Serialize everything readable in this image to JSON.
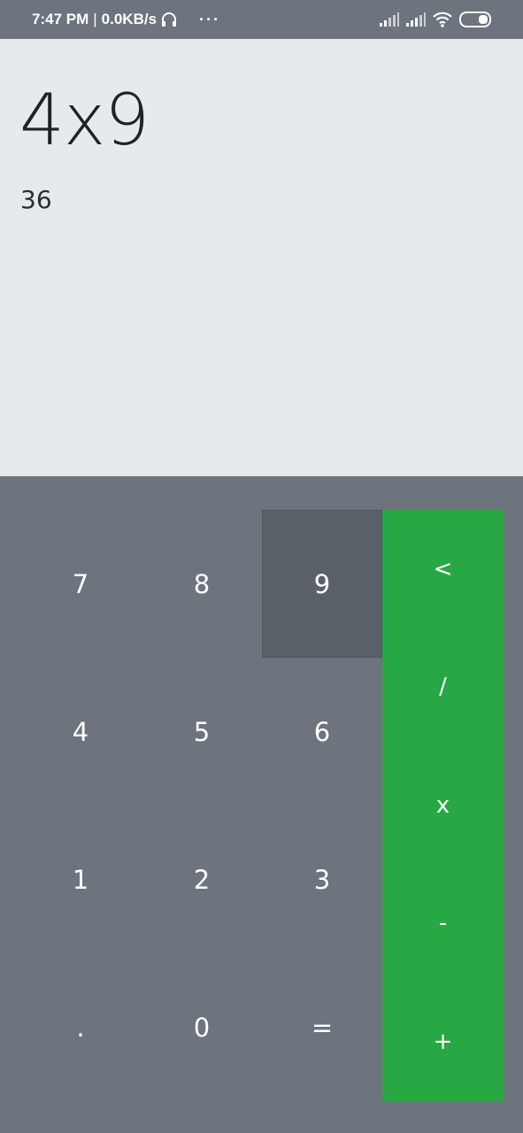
{
  "status_bar": {
    "time": "7:47 PM",
    "separator": "|",
    "network_speed": "0.0KB/s",
    "headset_icon": "headset-icon",
    "more_icon": "more-icon",
    "more_glyph": "···",
    "signal_icon_1": "signal-icon",
    "signal_icon_2": "signal-icon",
    "wifi_icon": "wifi-icon",
    "battery_icon": "battery-icon"
  },
  "display": {
    "expression": "4x9",
    "result": "36"
  },
  "keypad": {
    "keys": [
      "7",
      "8",
      "9",
      "4",
      "5",
      "6",
      "1",
      "2",
      "3",
      ".",
      "0",
      "="
    ],
    "pressed_key": "9"
  },
  "operators": [
    "<",
    "/",
    "x",
    "-",
    "+"
  ],
  "colors": {
    "background": "#6d747d",
    "display_bg": "#e6eaed",
    "operator_panel": "#27a844",
    "pressed_key": "#5a6169",
    "text_light": "#ffffff",
    "text_dark": "#1f2328"
  }
}
